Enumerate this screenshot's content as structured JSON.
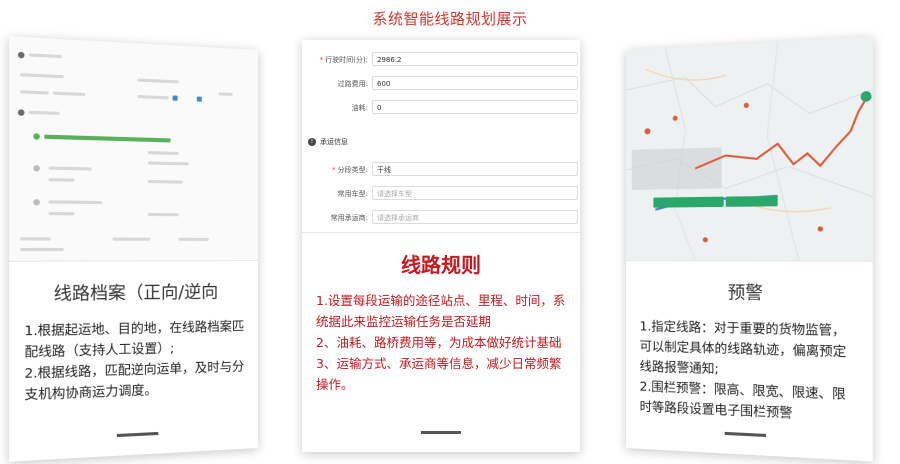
{
  "page": {
    "title": "系统智能线路规划展示"
  },
  "colors": {
    "accent": "#c8171e",
    "title": "#d4352b",
    "route": "#e05a3a",
    "map_bg": "#eef1f2"
  },
  "cards": {
    "left": {
      "heading": "线路档案（正向/逆向",
      "desc": [
        "1.根据起运地、目的地，在线路档案匹配线路（支持人工设置）;",
        "2.根据线路，匹配逆向运单，及时与分支机构协商运力调度。"
      ]
    },
    "center": {
      "heading": "线路规则",
      "desc": [
        "1.设置每段运输的途径站点、里程、时间，系统据此来监控运输任务是否延期",
        "2、油耗、路桥费用等，为成本做好统计基础",
        "3、运输方式、承运商等信息，减少日常频繁操作。"
      ],
      "form": {
        "fields": [
          {
            "label": "行驶时间(分):",
            "required": true,
            "value": "2986.2"
          },
          {
            "label": "过路费用:",
            "required": false,
            "value": "600"
          },
          {
            "label": "油耗:",
            "required": false,
            "value": "0"
          }
        ],
        "section": "承运信息",
        "fields2": [
          {
            "label": "分段类型:",
            "required": true,
            "value": "干线",
            "placeholder": ""
          },
          {
            "label": "常用车型:",
            "required": false,
            "value": "",
            "placeholder": "请选择车型"
          },
          {
            "label": "常用承运商:",
            "required": false,
            "value": "",
            "placeholder": "请选择承运商"
          }
        ]
      }
    },
    "right": {
      "heading": "预警",
      "desc": [
        "1.指定线路：对于重要的货物监管，可以制定具体的线路轨迹，偏离预定线路报警通知;",
        "2.围栏预警：限高、限宽、限速、限时等路段设置电子围栏预警"
      ]
    }
  }
}
